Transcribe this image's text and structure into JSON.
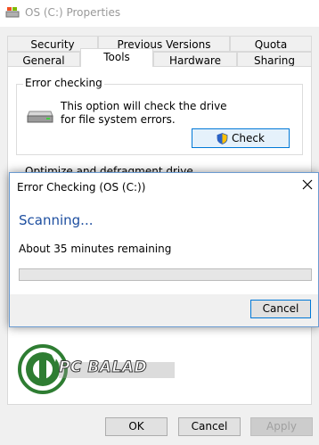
{
  "window": {
    "title": "OS (C:) Properties"
  },
  "tabs_row1": [
    "Security",
    "Previous Versions",
    "Quota"
  ],
  "tabs_row2": [
    "General",
    "Tools",
    "Hardware",
    "Sharing"
  ],
  "active_tab": "Tools",
  "error_checking": {
    "group_label": "Error checking",
    "description": "This option will check the drive for file system errors.",
    "check_button": "Check"
  },
  "optimize": {
    "group_label": "Optimize and defragment drive"
  },
  "footer": {
    "ok": "OK",
    "cancel": "Cancel",
    "apply": "Apply"
  },
  "dialog": {
    "title": "Error Checking (OS (C:))",
    "heading": "Scanning...",
    "status": "About 35 minutes remaining",
    "progress_percent": 0,
    "cancel": "Cancel"
  },
  "watermark": {
    "text": "PC BALAD"
  },
  "colors": {
    "accent": "#0078d7",
    "heading": "#1e4fa0",
    "progress": "#06b025"
  }
}
